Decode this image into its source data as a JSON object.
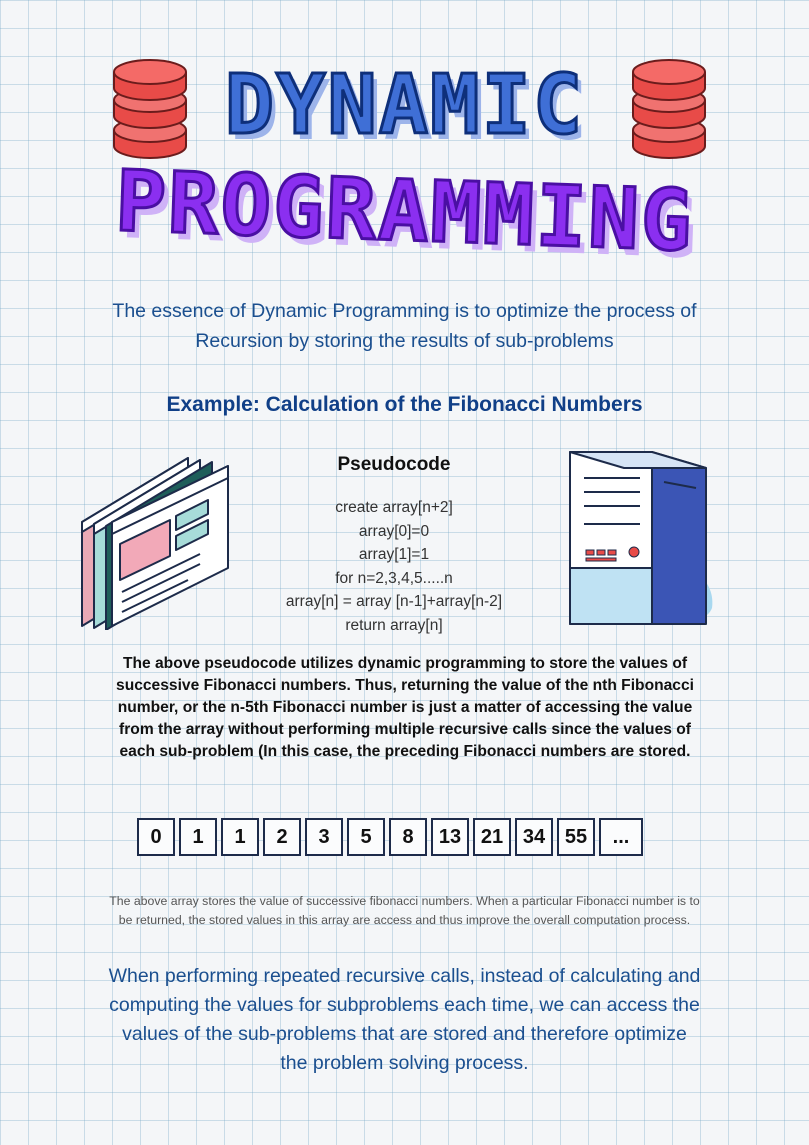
{
  "title_line1": "DYNAMIC",
  "title_line2": "PROGRAMMING",
  "intro_line1": "The essence of Dynamic Programming is to optimize the process of",
  "intro_line2": "Recursion by storing the results of sub-problems",
  "example_heading": "Example: Calculation of the Fibonacci Numbers",
  "pseudocode_heading": "Pseudocode",
  "pseudocode": [
    "create array[n+2]",
    "array[0]=0",
    "array[1]=1",
    "for n=2,3,4,5.....n",
    "array[n] = array [n-1]+array[n-2]",
    "return array[n]"
  ],
  "explanation": [
    "The above pseudocode utilizes dynamic programming to store the values of",
    "successive Fibonacci numbers. Thus, returning the value of the nth Fibonacci",
    "number, or the n-5th Fibonacci number is just a matter of accessing the value",
    "from the array without performing multiple recursive calls since the values of",
    "each sub-problem (In this case, the preceding Fibonacci numbers are stored."
  ],
  "fib_array": [
    "0",
    "1",
    "1",
    "2",
    "3",
    "5",
    "8",
    "13",
    "21",
    "34",
    "55",
    "..."
  ],
  "array_note": [
    "The above array stores the value of successive fibonacci numbers. When a particular Fibonacci number is to",
    "be returned, the stored values in this array are access and thus improve the overall computation process."
  ],
  "conclusion": [
    "When performing repeated recursive calls, instead of calculating and",
    "computing the values for subproblems each time, we can access the",
    "values of the sub-problems that are stored and therefore optimize",
    "the problem solving process."
  ],
  "icons": [
    "database-icon",
    "browser-windows-icon",
    "server-tower-icon"
  ],
  "colors": {
    "title1": "#3f6fd6",
    "title2": "#8b2ff0",
    "heading": "#103f87",
    "body_blue": "#1b4f8f",
    "database": "#e84b48"
  }
}
